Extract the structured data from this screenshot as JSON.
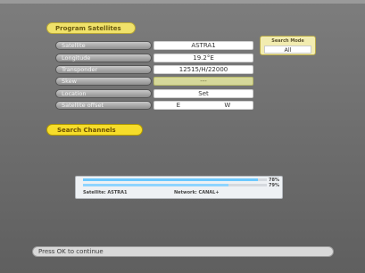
{
  "title": "Program Satellites",
  "fields": [
    {
      "label": "Satellite",
      "value": "ASTRA1"
    },
    {
      "label": "Longitude",
      "value": "19.2°E"
    },
    {
      "label": "Transponder",
      "value": "12515/H/22000"
    },
    {
      "label": "Skew",
      "value": "---"
    },
    {
      "label": "Location",
      "value": "Set"
    },
    {
      "label": "Satellite offset",
      "left": "E",
      "right": "W"
    }
  ],
  "search_mode": {
    "title": "Search Mode",
    "value": "All"
  },
  "search_button": {
    "label": "Search Channels"
  },
  "signal": {
    "strength_percent": 95,
    "quality_percent": 79,
    "strength_label": "78%",
    "quality_label": "79%",
    "satellite_text": "Satellite: ASTRA1",
    "network_text": "Network: CANAL+"
  },
  "status": "Press OK to continue",
  "colors": {
    "title_yellow": "#f0e26a",
    "button_yellow": "#f6dd2a",
    "bar_blue": "#6cc8ff"
  }
}
